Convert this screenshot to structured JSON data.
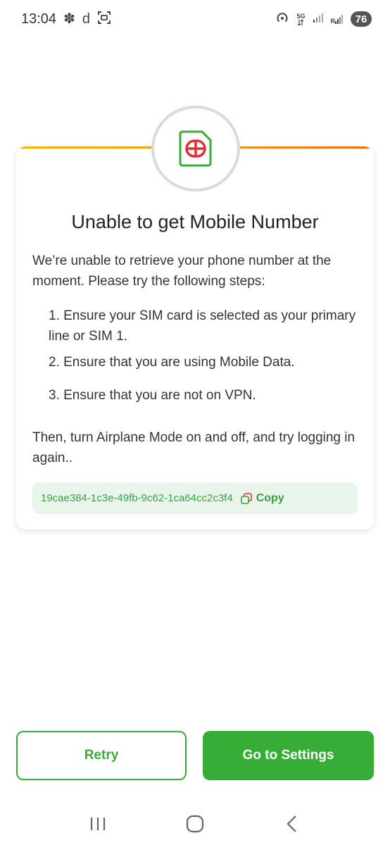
{
  "status_bar": {
    "time": "13:04",
    "glyph_1": "✽",
    "glyph_2": "d",
    "network_label": "5G",
    "signal_label": "R",
    "battery": "76"
  },
  "card": {
    "title": "Unable to get Mobile Number",
    "intro": "We’re unable to retrieve your phone number at the moment. Please try the following steps:",
    "steps": [
      "1. Ensure your SIM card is selected as your primary line or SIM 1.",
      "2. Ensure that you are using Mobile Data.",
      "3. Ensure that you are not on VPN."
    ],
    "footer": "Then, turn Airplane Mode on and off, and try logging in again..",
    "error_id": "19cae384-1c3e-49fb-9c62-1ca64cc2c3f4",
    "copy_label": "Copy"
  },
  "actions": {
    "retry_label": "Retry",
    "settings_label": "Go to Settings"
  },
  "colors": {
    "brand_green": "#37ac37",
    "sim_red": "#e0303a",
    "accent_orange": "#f39c12"
  },
  "icons": {
    "sim": "sim-card-icon",
    "copy": "copy-icon",
    "recents": "recent-apps-icon",
    "home": "home-icon",
    "back": "back-icon"
  }
}
